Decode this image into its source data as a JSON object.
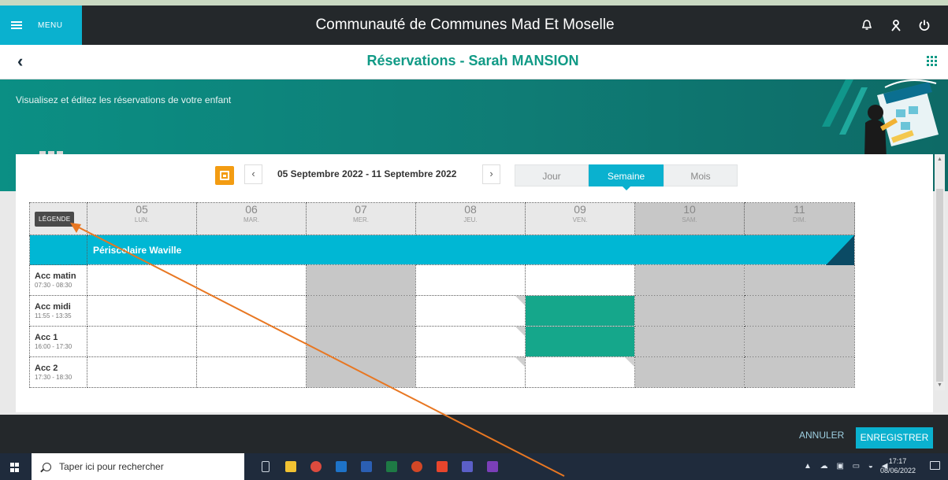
{
  "header": {
    "menu_label": "MENU",
    "app_title": "Communauté de Communes Mad Et Moselle"
  },
  "subheader": {
    "back_symbol": "‹",
    "page_title": "Réservations  -  Sarah MANSION"
  },
  "banner": {
    "text": "Visualisez et éditez les réservations de votre enfant"
  },
  "calendar": {
    "date_range": "05 Septembre 2022 - 11 Septembre 2022",
    "prev_symbol": "‹",
    "next_symbol": "›",
    "views": [
      "Jour",
      "Semaine",
      "Mois"
    ],
    "active_view": "Semaine",
    "legend_label": "LÉGENDE",
    "days": [
      {
        "num": "05",
        "name": "LUN."
      },
      {
        "num": "06",
        "name": "MAR."
      },
      {
        "num": "07",
        "name": "MER."
      },
      {
        "num": "08",
        "name": "JEU."
      },
      {
        "num": "09",
        "name": "VEN."
      },
      {
        "num": "10",
        "name": "SAM."
      },
      {
        "num": "11",
        "name": "DIM."
      }
    ],
    "section_title": "Périscolaire Waville",
    "rows": [
      {
        "name": "Acc matin",
        "time": "07:30 - 08:30",
        "cells": [
          "empty",
          "empty",
          "closed",
          "empty",
          "empty",
          "closed",
          "closed"
        ]
      },
      {
        "name": "Acc midi",
        "time": "11:55 - 13:35",
        "cells": [
          "empty",
          "empty",
          "closed",
          "empty",
          "reserved",
          "closed",
          "closed"
        ]
      },
      {
        "name": "Acc 1",
        "time": "16:00 - 17:30",
        "cells": [
          "empty",
          "empty",
          "closed",
          "empty",
          "reserved",
          "closed",
          "closed"
        ]
      },
      {
        "name": "Acc 2",
        "time": "17:30 - 18:30",
        "cells": [
          "empty",
          "empty",
          "closed",
          "empty",
          "empty",
          "closed",
          "closed"
        ]
      }
    ]
  },
  "footer": {
    "cancel_label": "ANNULER",
    "save_label": "ENREGISTRER"
  },
  "taskbar": {
    "search_placeholder": "Taper ici pour rechercher",
    "time": "17:17",
    "date": "08/06/2022"
  },
  "colors": {
    "accent": "#0ab1cf",
    "reserved": "#15a78b",
    "closed": "#c7c7c7",
    "title": "#119a86",
    "annotation_arrow": "#e87722"
  }
}
